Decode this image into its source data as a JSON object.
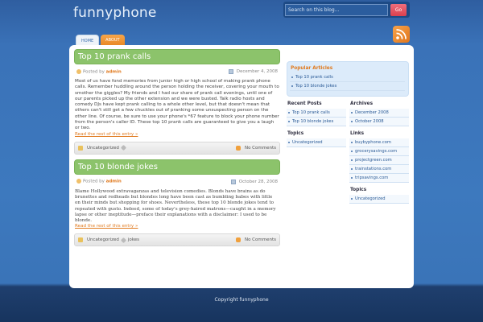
{
  "site": {
    "title": "funnyphone"
  },
  "search": {
    "placeholder": "Search on this blog...",
    "button": "Go"
  },
  "nav": {
    "tabs": [
      {
        "label": "HOME"
      },
      {
        "label": "ABOUT"
      }
    ]
  },
  "posts": [
    {
      "title": "Top 10 prank calls",
      "posted_by": "Posted by",
      "author": "admin",
      "date": "December 4, 2008",
      "body": "Most of us have fond memories from junior high or high school of making prank phone calls. Remember huddling around the person holding the receiver, covering your mouth to smother the giggles? My friends and I had our share of prank call evenings, until one of our parents picked up the other extension and we were busted. Talk radio hosts and comedy DJs have kept prank calling to a whole other level, but that doesn't mean that others can't still get a few chuckles out of pranking some unsuspecting person on the other line. Of course, be sure to use your phone's *67 feature to block your phone number from the person's caller ID. These top 10 prank calls are guaranteed to give you a laugh or two.",
      "more": "Read the rest of this entry »",
      "category": "Uncategorized",
      "tags": "",
      "comments": "No Comments"
    },
    {
      "title": "Top 10 blonde jokes",
      "posted_by": "Posted by",
      "author": "admin",
      "date": "October 28, 2008",
      "body": "Blame Hollywood extravaganzas and television comedies. Blonds have brains as do brunettes and redheads but blondes long have been cast as bumbling babes with little on their minds but shopping for shoes. Nevertheless, these top 10 blonde jokes tend to repeated with gusto. Indeed, some of today's grey-haired matrons—caught in a memory lapse or other ineptitude—preface their explanations with a disclaimer: I used to be blonde.",
      "more": "Read the rest of this entry »",
      "category": "Uncategorized",
      "tags": "jokes",
      "comments": "No Comments"
    }
  ],
  "sidebar": {
    "popular": {
      "title": "Popular Articles",
      "items": [
        "Top 10 prank calls",
        "Top 10 blonde jokes"
      ]
    },
    "recent": {
      "title": "Recent Posts",
      "items": [
        "Top 10 prank calls",
        "Top 10 blonde jokes"
      ]
    },
    "topics_left": {
      "title": "Topics",
      "items": [
        "Uncategorized"
      ]
    },
    "archives": {
      "title": "Archives",
      "items": [
        "December 2008",
        "October 2008"
      ]
    },
    "links": {
      "title": "Links",
      "items": [
        "buybyphone.com",
        "grocerysavings.com",
        "projectgreen.com",
        "trainstations.com",
        "tripsavings.com"
      ]
    },
    "topics_right": {
      "title": "Topics",
      "items": [
        "Uncategorized"
      ]
    }
  },
  "footer": {
    "text": "Copyright funnyphone"
  },
  "colors": {
    "accent_orange": "#e07a1f",
    "post_title_green": "#8cc36b",
    "go_button": "#d9404f"
  }
}
